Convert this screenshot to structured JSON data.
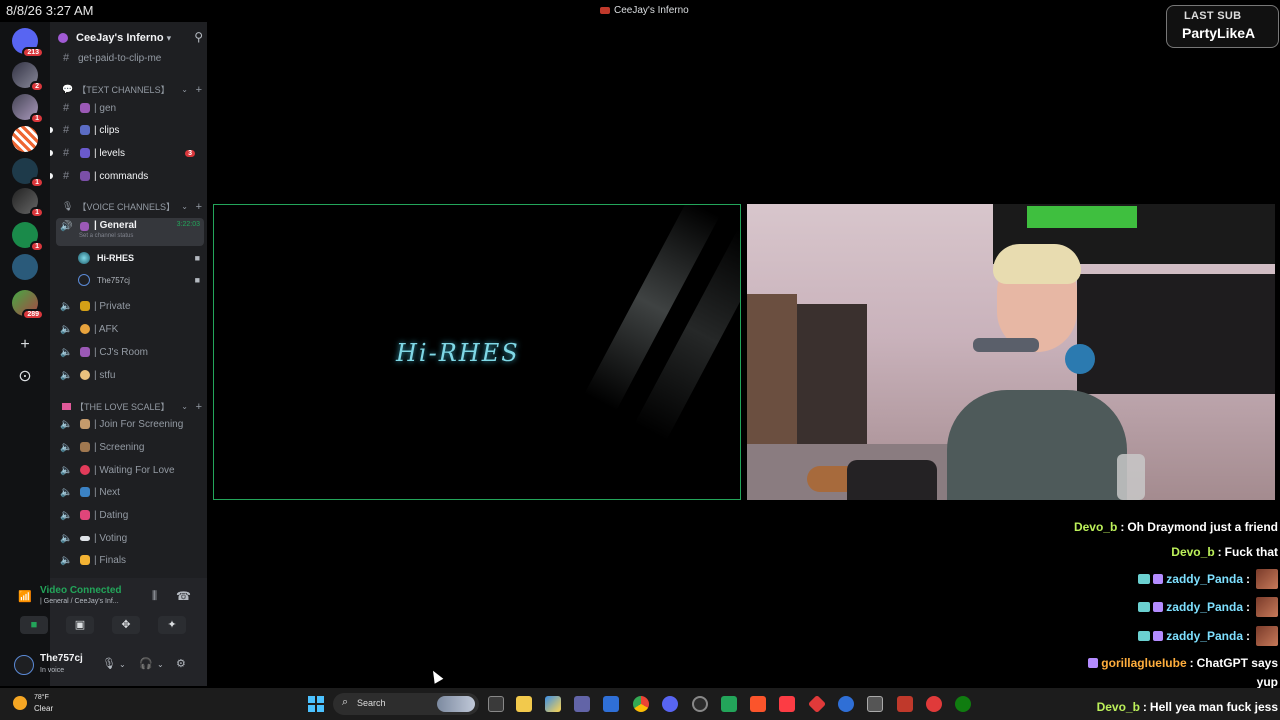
{
  "overlay": {
    "clock": "8/8/26 3:27 AM",
    "window_title": "CeeJay's Inferno",
    "last_sub_label": "LAST SUB",
    "last_sub_name": "PartyLikeA"
  },
  "rail": {
    "home_badge": "213",
    "badges": [
      "2",
      "1",
      "1",
      "1",
      "1",
      "289"
    ],
    "add_icon": "plus-icon",
    "explore_icon": "compass-icon"
  },
  "sidebar": {
    "server_name": "CeeJay's Inferno",
    "top_channel": "get-paid-to-clip-me",
    "text_category": "【TEXT CHANNELS】",
    "text_channels": [
      {
        "label": "| gen"
      },
      {
        "label": "| clips"
      },
      {
        "label": "| levels",
        "mentions": "3"
      },
      {
        "label": "| commands"
      }
    ],
    "voice_category": "【VOICE CHANNELS】",
    "active_channel": {
      "label": "| General",
      "timer": "3:22:03",
      "status": "Set a channel status"
    },
    "members": [
      "Hi-RHES",
      "The757cj"
    ],
    "voice_channels": [
      "| Private",
      "| AFK",
      "| CJ's Room",
      "| stfu"
    ],
    "love_category": "【THE LOVE SCALE】",
    "love_channels": [
      "| Join For Screening",
      "| Screening",
      "| Waiting For Love",
      "| Next",
      "| Dating",
      "| Voting",
      "| Finals"
    ]
  },
  "voice_panel": {
    "status": "Video Connected",
    "location": "| General / CeeJay's Inf...",
    "username": "The757cj",
    "user_status": "In voice"
  },
  "stream": {
    "logo_text": "Hi-RHES"
  },
  "chat": [
    {
      "user": "Devo_b",
      "message": "Oh Draymond just a friend"
    },
    {
      "user": "Devo_b",
      "message": "Fuck that"
    },
    {
      "user": "zaddy_Panda",
      "message": ""
    },
    {
      "user": "zaddy_Panda",
      "message": ""
    },
    {
      "user": "zaddy_Panda",
      "message": ""
    },
    {
      "user": "gorillaglueIube",
      "message": "ChatGPT says"
    },
    {
      "user": "",
      "message": "yup"
    },
    {
      "user": "Devo_b",
      "message": "Hell yea man fuck jess"
    }
  ],
  "taskbar": {
    "temperature": "78°F",
    "condition": "Clear",
    "search_placeholder": "Search"
  },
  "colors": {
    "accent_green": "#23a55a",
    "mention_red": "#da373c",
    "chat_user_green": "#bcf05a"
  }
}
